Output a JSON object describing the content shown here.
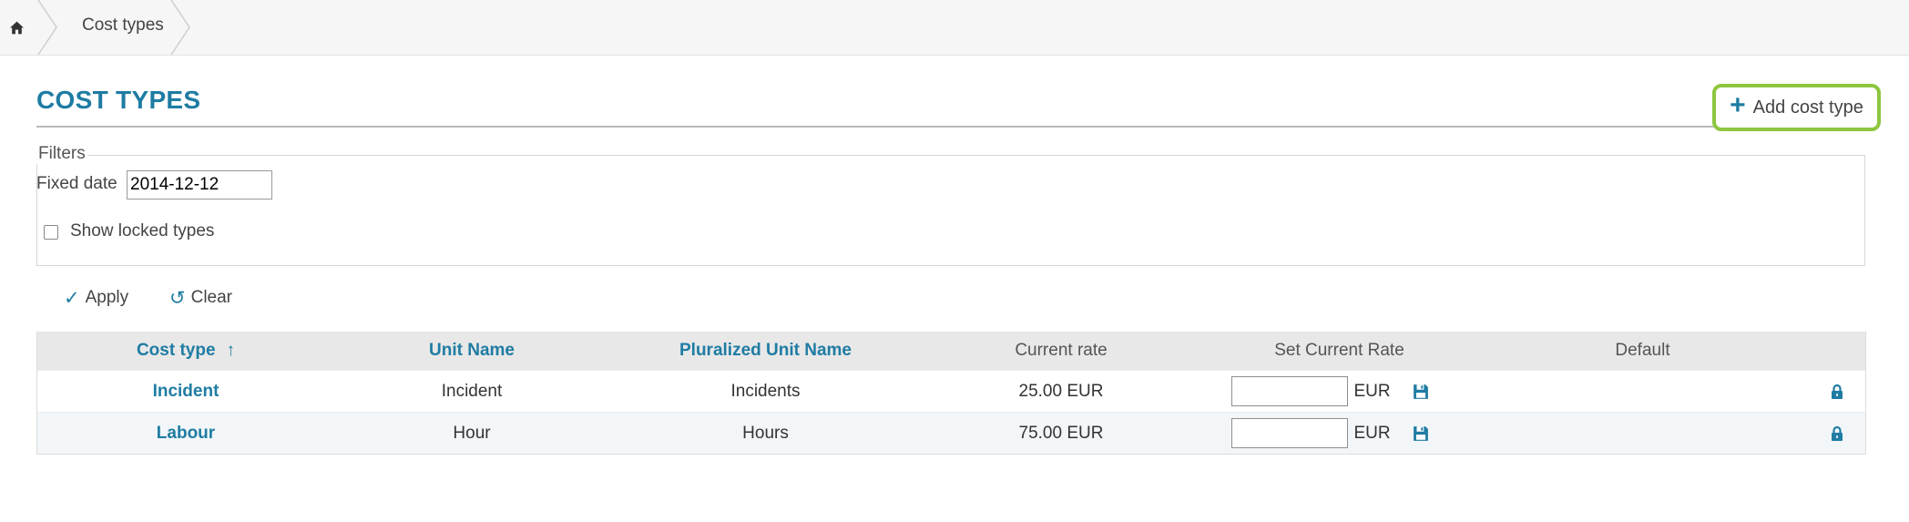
{
  "breadcrumb": {
    "home_icon": "home-icon",
    "current": "Cost types"
  },
  "header": {
    "title": "COST TYPES",
    "add_button": {
      "icon": "plus-icon",
      "label": "Add cost type"
    }
  },
  "filters": {
    "legend": "Filters",
    "fixed_date_label": "Fixed date",
    "fixed_date_value": "2014-12-12",
    "show_locked_label": "Show locked types",
    "show_locked_checked": false
  },
  "actions": {
    "apply": {
      "icon": "checkmark-icon",
      "label": "Apply"
    },
    "clear": {
      "icon": "undo-icon",
      "label": "Clear"
    }
  },
  "table": {
    "columns": [
      {
        "label": "Cost type",
        "sortable": true,
        "sort": "ascending"
      },
      {
        "label": "Unit Name",
        "sortable": true
      },
      {
        "label": "Pluralized Unit Name",
        "sortable": true
      },
      {
        "label": "Current rate",
        "sortable": false
      },
      {
        "label": "Set Current Rate",
        "sortable": false
      },
      {
        "label": "Default",
        "sortable": false
      },
      {
        "label": "",
        "sortable": false
      }
    ],
    "rows": [
      {
        "cost_type": "Incident",
        "unit_name": "Incident",
        "plural_unit_name": "Incidents",
        "current_rate": "25.00 EUR",
        "currency": "EUR",
        "save_icon": "floppy-disk-icon",
        "lock_icon": "lock-icon"
      },
      {
        "cost_type": "Labour",
        "unit_name": "Hour",
        "plural_unit_name": "Hours",
        "current_rate": "75.00 EUR",
        "currency": "EUR",
        "save_icon": "floppy-disk-icon",
        "lock_icon": "lock-icon"
      }
    ]
  },
  "colors": {
    "accent": "#1f7ca3",
    "highlight": "#8dc63f"
  }
}
